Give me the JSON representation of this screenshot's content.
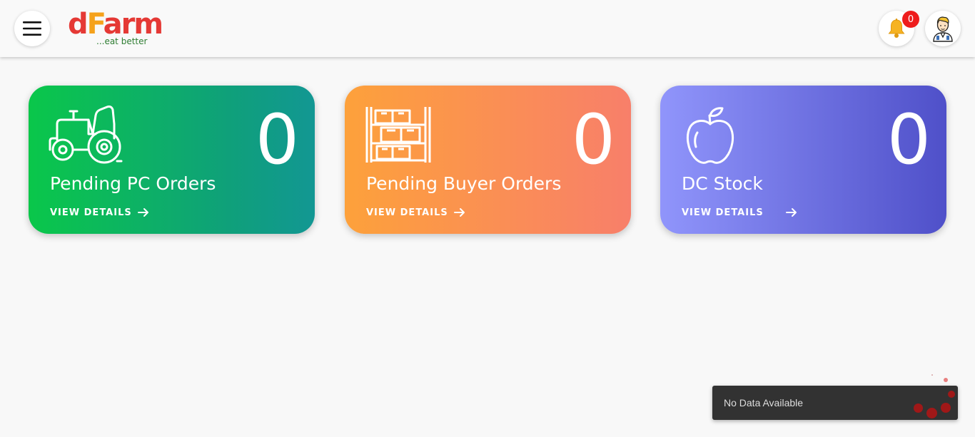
{
  "header": {
    "logo_main_d": "d",
    "logo_main_f": "F",
    "logo_main_rest": "arm",
    "logo_tagline": "...eat better",
    "notification_count": "0"
  },
  "cards": [
    {
      "title": "Pending PC Orders",
      "count": "0",
      "link_label": "VIEW DETAILS",
      "icon": "tractor-icon"
    },
    {
      "title": "Pending Buyer Orders",
      "count": "0",
      "link_label": "VIEW DETAILS",
      "icon": "warehouse-shelf-icon"
    },
    {
      "title": "DC Stock",
      "count": "0",
      "link_label": "VIEW DETAILS",
      "icon": "apple-icon"
    }
  ],
  "toast": {
    "message": "No Data Available"
  },
  "colors": {
    "card1": [
      "#0ac74a",
      "#129793"
    ],
    "card2": [
      "#fda13b",
      "#f87f6a"
    ],
    "card3": [
      "#9095fb",
      "#4f50c9"
    ],
    "badge": "#ee1c1c",
    "loader": "#a01818"
  }
}
